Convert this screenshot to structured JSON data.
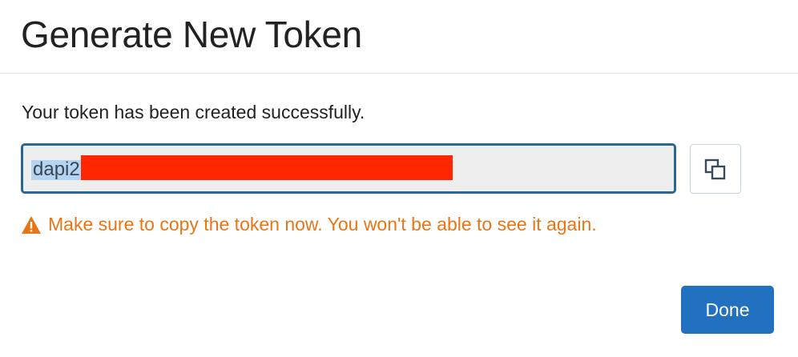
{
  "dialog": {
    "title": "Generate New Token",
    "success_message": "Your token has been created successfully.",
    "token_value": "dapi2",
    "warning_text": "Make sure to copy the token now. You won't be able to see it again.",
    "done_label": "Done"
  },
  "icons": {
    "copy": "copy-icon",
    "warning": "warning-triangle-icon"
  },
  "colors": {
    "accent": "#2271c1",
    "input_border": "#2b6592",
    "warning": "#e87617",
    "redaction": "#ff2600",
    "selection": "#b5d4f1"
  }
}
